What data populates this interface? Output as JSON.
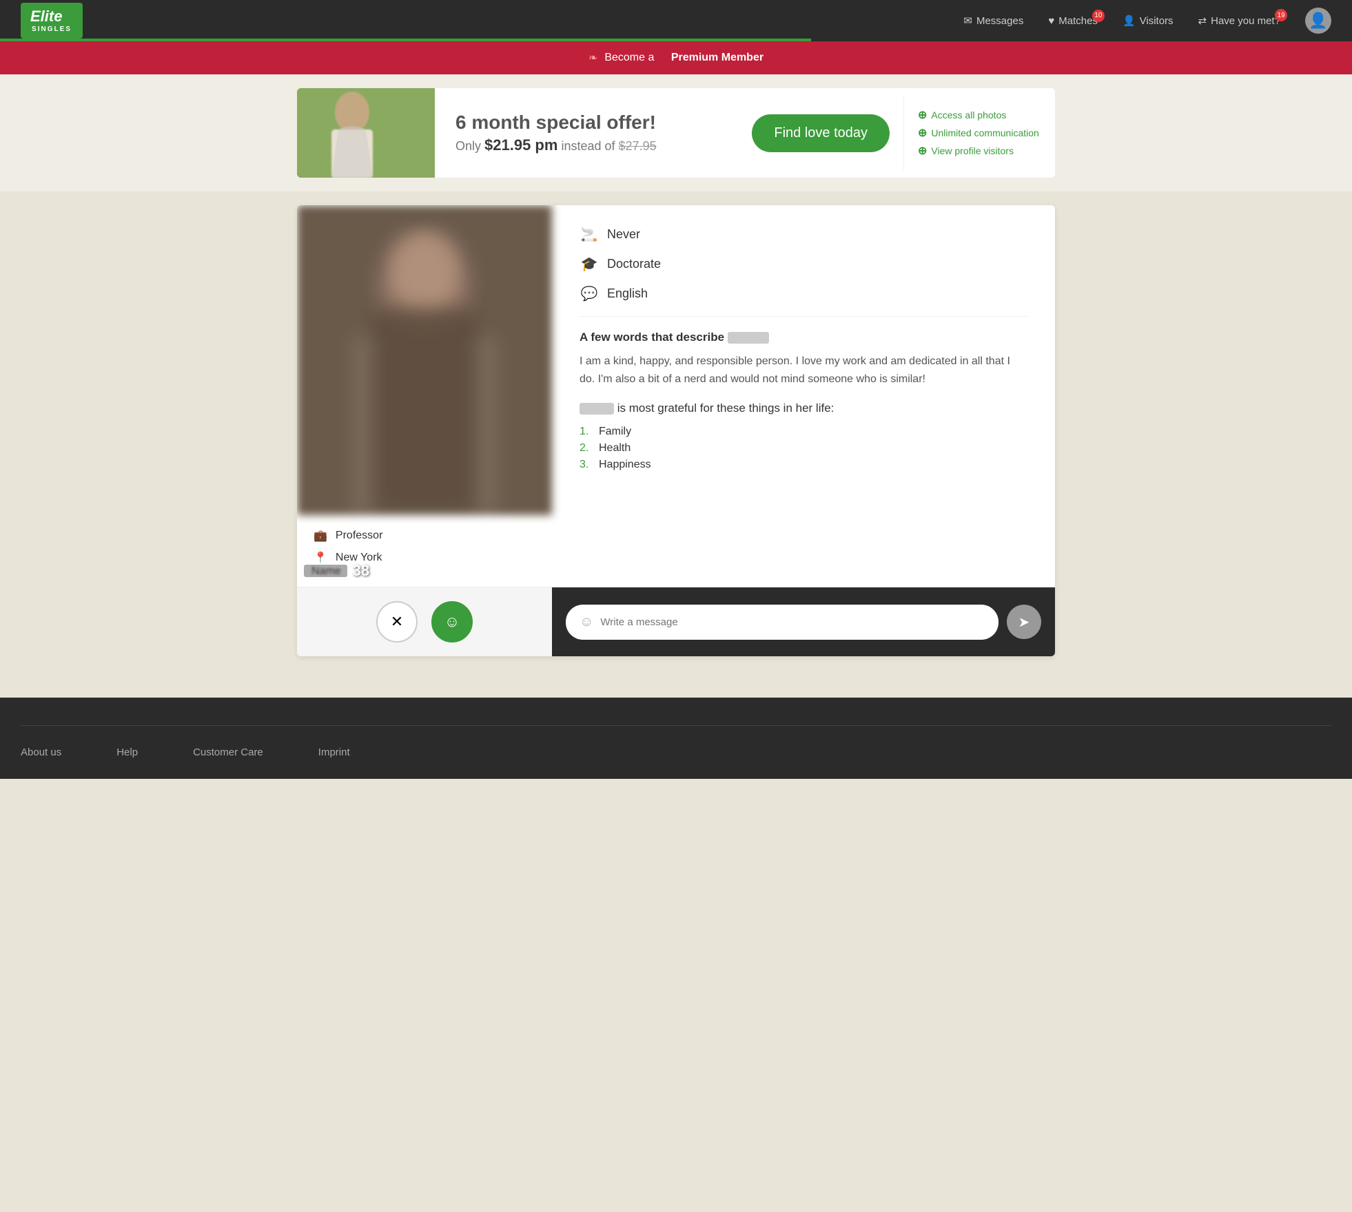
{
  "header": {
    "logo_text": "Elite",
    "logo_sub": "SINGLES",
    "nav": {
      "messages_label": "Messages",
      "matches_label": "Matches",
      "matches_badge": "10",
      "visitors_label": "Visitors",
      "have_you_met_label": "Have you met?",
      "have_you_met_badge": "19"
    },
    "progress_percent": 60
  },
  "premium_banner": {
    "text_normal": "Become a",
    "text_bold": "Premium Member"
  },
  "promo": {
    "title": "6 month special offer!",
    "price_text": "Only",
    "price_value": "$21.95 pm",
    "price_instead": "instead of",
    "price_old": "$27.95",
    "cta_label": "Find love today",
    "features": [
      "Access all photos",
      "Unlimited communication",
      "View profile visitors"
    ]
  },
  "profile": {
    "age": "38",
    "smoking": "Never",
    "education": "Doctorate",
    "language": "English",
    "occupation": "Professor",
    "location": "New York",
    "describe_title": "A few words that describe",
    "describe_text": "I am a kind, happy, and responsible person. I love my work and am dedicated in all that I do. I'm also a bit of a nerd and would not mind someone who is similar!",
    "grateful_title": "is most grateful for these things in her life:",
    "grateful_list": [
      "Family",
      "Health",
      "Happiness"
    ]
  },
  "message": {
    "placeholder": "Write a message"
  },
  "footer": {
    "about_label": "About us",
    "help_label": "Help",
    "customer_care_label": "Customer Care",
    "imprint_label": "Imprint"
  }
}
